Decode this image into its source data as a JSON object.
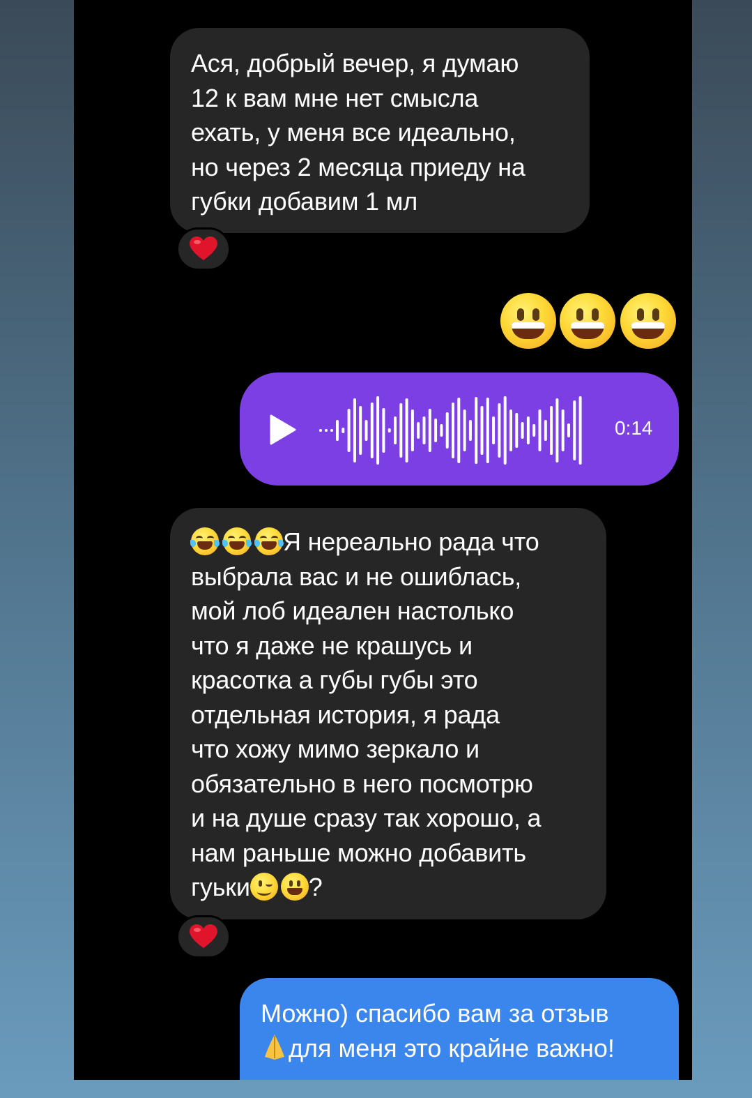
{
  "colors": {
    "incoming_bubble": "#262626",
    "voice_bubble": "#7b3fe4",
    "outgoing_bubble": "#3a86ec",
    "reaction_heart": "#e0142a"
  },
  "messages": {
    "first": {
      "lines": [
        "Ася, добрый вечер, я думаю",
        "12 к вам мне нет смысла",
        "ехать, у меня все идеально,",
        "но через 2 месяца приеду на",
        "губки добавим 1 мл"
      ],
      "reaction": "heart-icon"
    },
    "emoji_reply": {
      "icons": [
        "grinning-face-icon",
        "grinning-face-icon",
        "grinning-face-icon"
      ]
    },
    "voice": {
      "duration": "0:14",
      "icon": "play-icon"
    },
    "review": {
      "leading_emojis": [
        "joy-face-icon",
        "joy-face-icon",
        "joy-face-icon"
      ],
      "line1": "Я нереально рада что",
      "lines": [
        "выбрала вас и   не ошиблась,",
        "мой лоб идеален настолько",
        "что я даже не крашусь и",
        "красотка а губы губы это",
        "отдельная история, я рада",
        "что хожу мимо зеркало и",
        "обязательно в него посмотрю",
        "и на душе сразу так хорошо, а",
        "нам раньше можно добавить"
      ],
      "last_line_text": "гуьки",
      "last_line_emojis": [
        "winking-face-icon",
        "grinning-face-icon"
      ],
      "last_line_end": "?",
      "reaction": "heart-icon"
    },
    "reply": {
      "line1": "Можно) спасибо вам за отзыв",
      "line2_icon": "folded-hands-icon",
      "line2": "для меня это крайне важно!"
    }
  }
}
